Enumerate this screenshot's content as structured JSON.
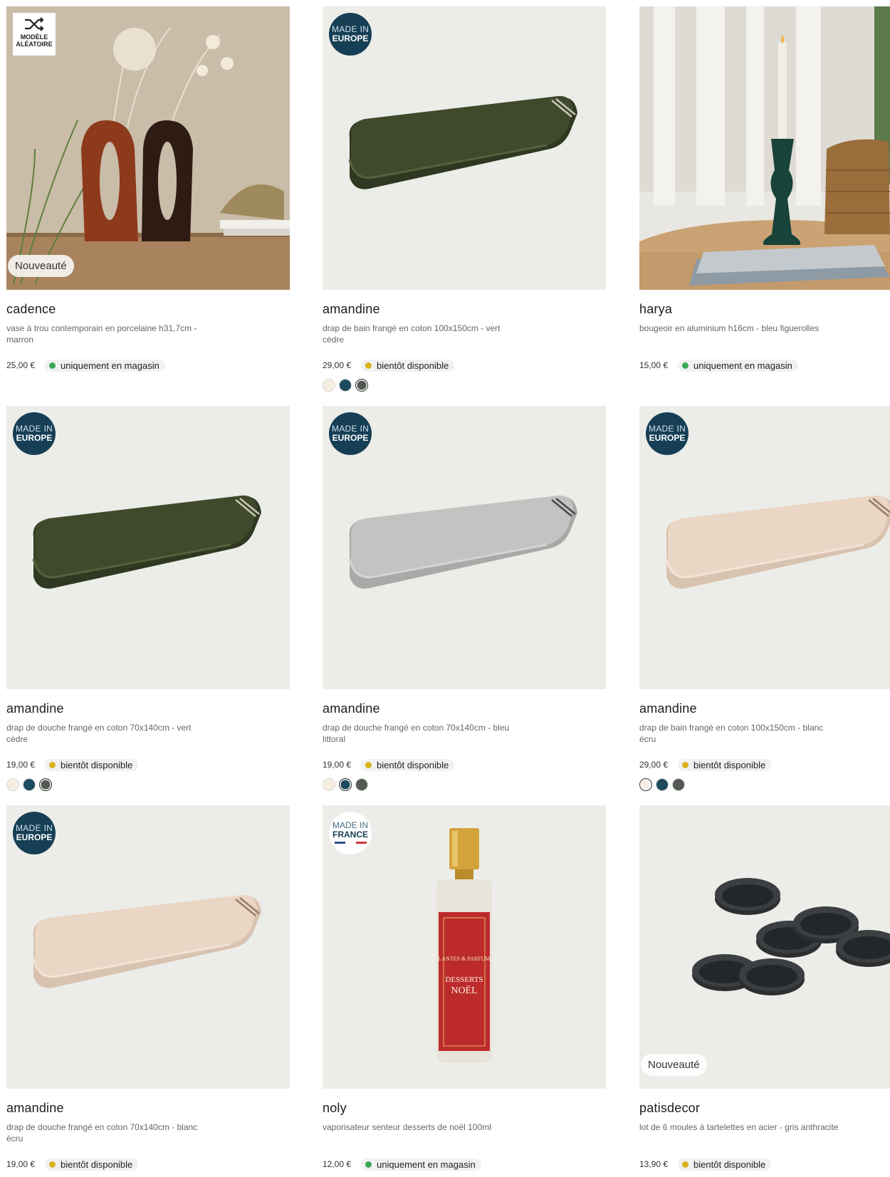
{
  "colors": {
    "green_dot": "#3aa856",
    "yellow_dot": "#d9b21c",
    "made_badge": "#163f55"
  },
  "badges": {
    "new": "Nouveauté",
    "made_line1": "MADE IN",
    "made_europe": "EUROPE",
    "made_france": "FRANCE",
    "random_line1": "MODÈLE",
    "random_line2": "ALÉATOIRE"
  },
  "products": [
    {
      "name": "cadence",
      "desc": "vase à trou contemporain en porcelaine h31,7cm - marron",
      "price": "25,00 €",
      "availability": "uniquement en magasin",
      "status": "green",
      "image": "vases",
      "badge_top": "random",
      "badge_new": true,
      "swatches": []
    },
    {
      "name": "amandine",
      "desc": "drap de bain frangé en coton 100x150cm - vert cèdre",
      "price": "29,00 €",
      "availability": "bientôt disponible",
      "status": "yellow",
      "image": "towel-green",
      "badge_top": "europe",
      "badge_new": false,
      "swatches": [
        {
          "color": "#f6eee2",
          "selected": false
        },
        {
          "color": "#1d4a5f",
          "selected": false
        },
        {
          "color": "#535a52",
          "selected": true
        }
      ]
    },
    {
      "name": "harya",
      "desc": "bougeoir en aluminium h16cm - bleu figuerolles",
      "price": "15,00 €",
      "availability": "uniquement en magasin",
      "status": "green",
      "image": "candle",
      "badge_top": "none",
      "badge_new": false,
      "swatches": []
    },
    {
      "name": "amandine",
      "desc": "drap de douche frangé en coton 70x140cm - vert cèdre",
      "price": "19,00 €",
      "availability": "bientôt disponible",
      "status": "yellow",
      "image": "towel-green",
      "badge_top": "europe",
      "badge_new": false,
      "swatches": [
        {
          "color": "#f6eee2",
          "selected": false
        },
        {
          "color": "#1d4a5f",
          "selected": false
        },
        {
          "color": "#535a52",
          "selected": true
        }
      ]
    },
    {
      "name": "amandine",
      "desc": "drap de douche frangé en coton 70x140cm - bleu littoral",
      "price": "19,00 €",
      "availability": "bientôt disponible",
      "status": "yellow",
      "image": "towel-grey",
      "badge_top": "europe",
      "badge_new": false,
      "swatches": [
        {
          "color": "#f6eee2",
          "selected": false
        },
        {
          "color": "#1d4a5f",
          "selected": true
        },
        {
          "color": "#535a52",
          "selected": false
        }
      ]
    },
    {
      "name": "amandine",
      "desc": "drap de bain frangé en coton 100x150cm - blanc écru",
      "price": "29,00 €",
      "availability": "bientôt disponible",
      "status": "yellow",
      "image": "towel-beige",
      "badge_top": "europe",
      "badge_new": false,
      "swatches": [
        {
          "color": "#f6eee2",
          "selected": true
        },
        {
          "color": "#1d4a5f",
          "selected": false
        },
        {
          "color": "#535a52",
          "selected": false
        }
      ]
    },
    {
      "name": "amandine",
      "desc": "drap de douche frangé en coton 70x140cm - blanc écru",
      "price": "19,00 €",
      "availability": "bientôt disponible",
      "status": "yellow",
      "image": "towel-beige",
      "badge_top": "europe",
      "badge_new": false,
      "swatches": []
    },
    {
      "name": "noly",
      "desc": "vaporisateur senteur desserts de noël 100ml",
      "price": "12,00 €",
      "availability": "uniquement en magasin",
      "status": "green",
      "image": "spray",
      "badge_top": "france",
      "badge_new": false,
      "swatches": []
    },
    {
      "name": "patisdecor",
      "desc": "lot de 6 moules à tartelettes en acier - gris anthracite",
      "price": "13,90 €",
      "availability": "bientôt disponible",
      "status": "yellow",
      "image": "molds",
      "badge_top": "none",
      "badge_new": true,
      "swatches": []
    }
  ],
  "spray_label": {
    "brand": "PLANTES & PARFUMS",
    "title": "DESSERTS DE NOËL"
  }
}
